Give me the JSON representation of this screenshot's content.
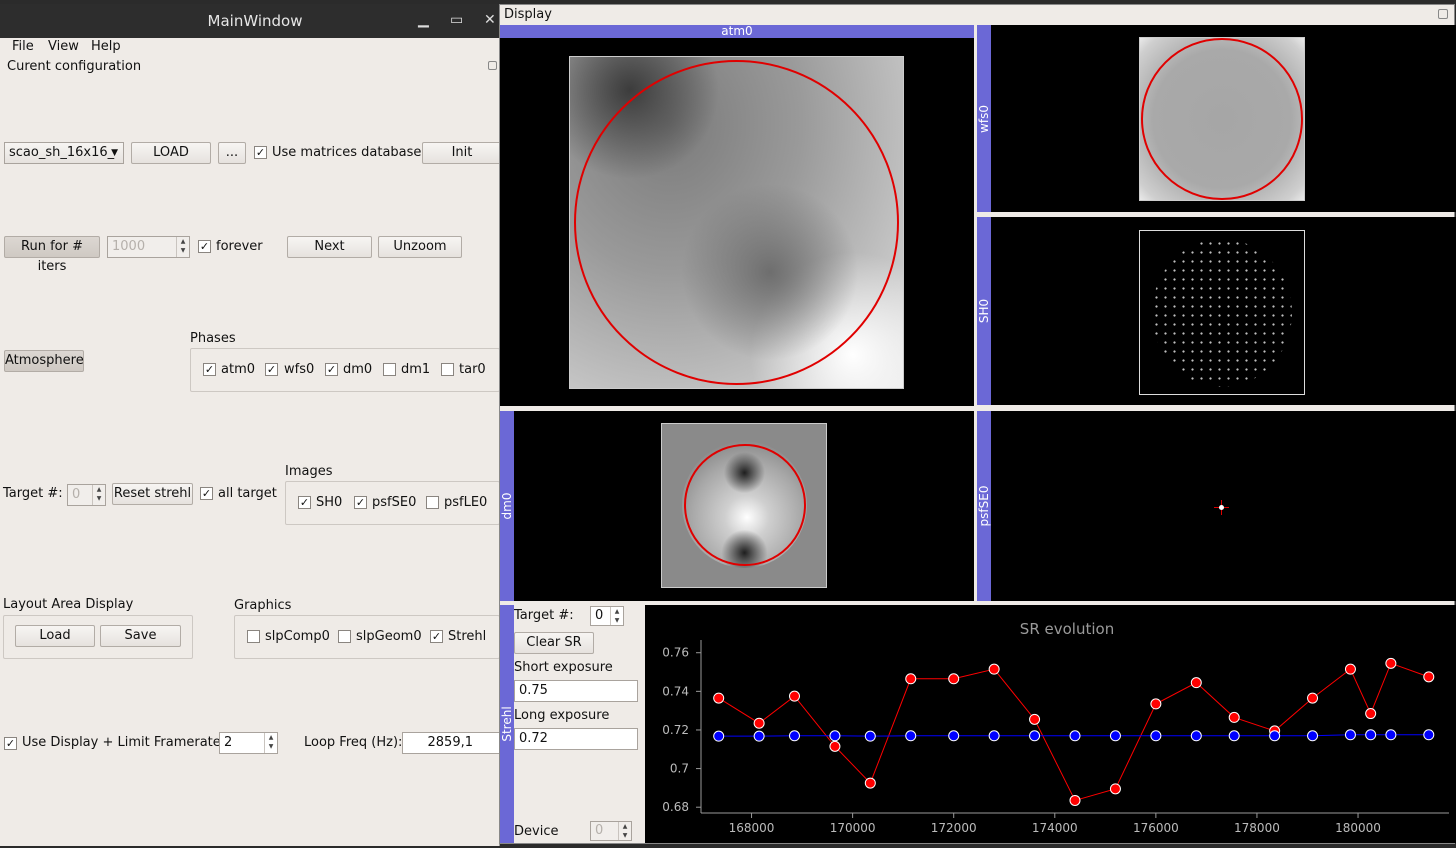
{
  "main_window": {
    "title": "MainWindow",
    "menu": [
      "File",
      "View",
      "Help"
    ],
    "section_config": "Curent configuration",
    "config_select": "scao_sh_16x16_",
    "load_button": "LOAD",
    "browse_button": "...",
    "use_matrices_db": {
      "label": "Use matrices database",
      "checked": true
    },
    "init_button": "Init",
    "run_button": "Run for # iters",
    "iters_placeholder": "1000",
    "forever": {
      "label": "forever",
      "checked": true
    },
    "next_button": "Next",
    "unzoom_button": "Unzoom",
    "atmosphere_button": "Atmosphere",
    "phases_title": "Phases",
    "phases": [
      {
        "label": "atm0",
        "checked": true
      },
      {
        "label": "wfs0",
        "checked": true
      },
      {
        "label": "dm0",
        "checked": true
      },
      {
        "label": "dm1",
        "checked": false
      },
      {
        "label": "tar0",
        "checked": false
      }
    ],
    "target_label": "Target #:",
    "target_value": "0",
    "reset_strehl_button": "Reset strehl",
    "all_target": {
      "label": "all target",
      "checked": true
    },
    "images_title": "Images",
    "images": [
      {
        "label": "SH0",
        "checked": true
      },
      {
        "label": "psfSE0",
        "checked": true
      },
      {
        "label": "psfLE0",
        "checked": false
      }
    ],
    "layout_title": "Layout Area Display",
    "layout_load": "Load",
    "layout_save": "Save",
    "graphics_title": "Graphics",
    "graphics": [
      {
        "label": "slpComp0",
        "checked": false
      },
      {
        "label": "slpGeom0",
        "checked": false
      },
      {
        "label": "Strehl",
        "checked": true
      }
    ],
    "use_display": {
      "label": "Use Display + Limit Framerate",
      "checked": true
    },
    "framerate_value": "2",
    "loop_freq_label": "Loop Freq (Hz):",
    "loop_freq_value": "2859,1"
  },
  "display": {
    "title": "Display",
    "panels": {
      "atm": "atm0",
      "wfs": "wfs0",
      "sh": "SH0",
      "dm": "dm0",
      "psf": "psfSE0",
      "strehl": "Strehl"
    },
    "strehl_controls": {
      "target_label": "Target #:",
      "target_value": "0",
      "clear_button": "Clear SR",
      "short_label": "Short exposure",
      "short_value": "0.75",
      "long_label": "Long exposure",
      "long_value": "0.72",
      "device_label": "Device",
      "device_value": "0"
    }
  },
  "chart_data": {
    "type": "scatter",
    "title": "SR evolution",
    "xlabel": "",
    "ylabel": "",
    "xlim": [
      167000,
      181800
    ],
    "ylim": [
      0.677,
      0.764
    ],
    "x_ticks": [
      168000,
      170000,
      172000,
      174000,
      176000,
      178000,
      180000
    ],
    "y_ticks": [
      0.68,
      0.7,
      0.72,
      0.74,
      0.76
    ],
    "y_tick_labels": [
      "0.68",
      "0.7",
      "0.72",
      "0.74",
      "0.76"
    ],
    "colors": {
      "short": "#ff0000",
      "long": "#0000ff"
    },
    "series": [
      {
        "x": [
          167350,
          168150,
          168850,
          169650,
          170350,
          171150,
          172000,
          172800,
          173600,
          174400,
          175200,
          176000,
          176800,
          177550,
          178350,
          179100,
          179850,
          180250,
          180650,
          181400
        ],
        "values": [
          0.7365,
          0.7235,
          0.7375,
          0.7115,
          0.6925,
          0.7465,
          0.7465,
          0.7515,
          0.7255,
          0.6835,
          0.6895,
          0.7335,
          0.7445,
          0.7265,
          0.7195,
          0.7365,
          0.7515,
          0.7285,
          0.7545,
          0.7475
        ]
      },
      {
        "x": [
          167350,
          168150,
          168850,
          169650,
          170350,
          171150,
          172000,
          172800,
          173600,
          174400,
          175200,
          176000,
          176800,
          177550,
          178350,
          179100,
          179850,
          180250,
          180650,
          181400
        ],
        "values": [
          0.7168,
          0.7168,
          0.717,
          0.717,
          0.7168,
          0.717,
          0.717,
          0.717,
          0.717,
          0.717,
          0.717,
          0.717,
          0.717,
          0.717,
          0.717,
          0.717,
          0.7175,
          0.7175,
          0.7175,
          0.7175
        ]
      }
    ]
  }
}
